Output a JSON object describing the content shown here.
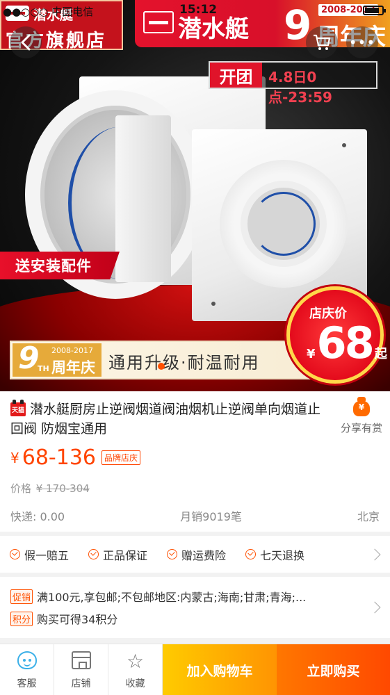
{
  "status_bar": {
    "carrier": "●●○○○ 中国电信",
    "time": "15:12"
  },
  "hero": {
    "brand_name": "潜水艇",
    "brand_subtitle": "官方旗舰店",
    "promo_brand": "潜水艇",
    "promo_number": "9",
    "promo_years": "2008-2017",
    "promo_anniversary": "周年庆",
    "group_label": "开团",
    "group_time": "4.8日0点-23:59",
    "install_ribbon": "送安装配件",
    "banner_nine": "9",
    "banner_th": "TH",
    "banner_years": "2008-2017",
    "banner_anniversary": "周年庆",
    "banner_text": "通用升级·耐温耐用",
    "seal_label": "店庆价",
    "seal_yen": "¥",
    "seal_price": "68",
    "seal_suffix": "起"
  },
  "product": {
    "tmall_badge": "天猫",
    "title": "潜水艇厨房止逆阀烟道阀油烟机止逆阀单向烟道止回阀 防烟宝通用",
    "share_label": "分享有赏",
    "price_currency": "¥",
    "price_range": "68-136",
    "brand_badge": "品牌店庆",
    "orig_label": "价格",
    "orig_price": "¥ 170-304",
    "shipping": "快递: 0.00",
    "monthly_sales": "月销9019笔",
    "location": "北京"
  },
  "services": [
    "假一赔五",
    "正品保证",
    "赠运费险",
    "七天退换"
  ],
  "promotions": [
    {
      "tag": "促销",
      "text": "满100元,享包邮;不包邮地区:内蒙古;海南;甘肃;青海;..."
    },
    {
      "tag": "积分",
      "text": "购买可得34积分"
    }
  ],
  "bottom_bar": {
    "customer_service": "客服",
    "shop": "店铺",
    "favorite": "收藏",
    "add_to_cart": "加入购物车",
    "buy_now": "立即购买"
  },
  "colors": {
    "accent": "#ff4400",
    "cart_button": "#ffa300",
    "buy_button": "#ff5000",
    "tmall_red": "#e21a1a"
  },
  "icons": [
    "back-arrow-icon",
    "cart-icon",
    "more-icon",
    "share-bag-icon",
    "check-icon",
    "chevron-right-icon",
    "customer-service-icon",
    "shop-icon",
    "star-icon"
  ]
}
